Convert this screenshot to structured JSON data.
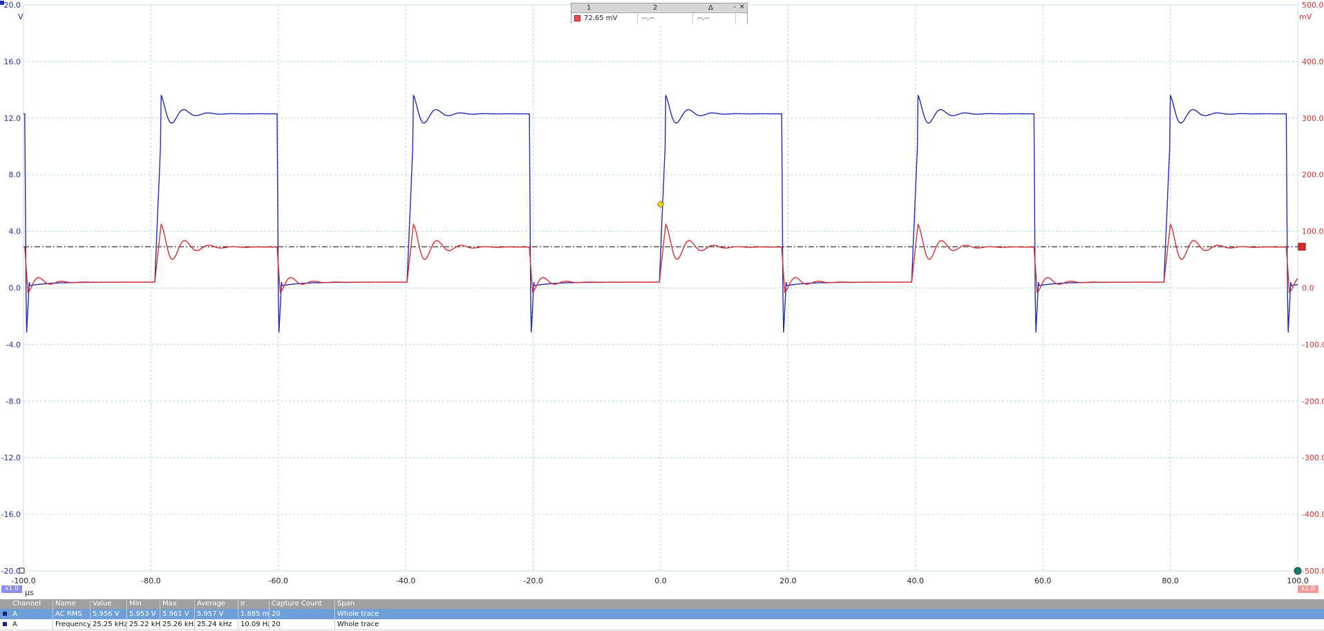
{
  "colors": {
    "channel_a": "#1f2bb4",
    "channel_b": "#d92d2d",
    "grid": "#b8d6dc",
    "trigger": "#e6d21a"
  },
  "axes": {
    "left_unit": "V",
    "right_unit": "mV",
    "x_unit": "µs",
    "left_ticks": [
      "20.0",
      "16.0",
      "12.0",
      "8.0",
      "4.0",
      "0.0",
      "-4.0",
      "-8.0",
      "-12.0",
      "-16.0",
      "-20.0"
    ],
    "right_ticks": [
      "500.0",
      "400.0",
      "300.0",
      "200.0",
      "100.0",
      "0.0",
      "-100.0",
      "-200.0",
      "-300.0",
      "-400.0",
      "-500.0"
    ],
    "x_ticks": [
      "-100.0",
      "-80.0",
      "-60.0",
      "-40.0",
      "-20.0",
      "0.0",
      "20.0",
      "40.0",
      "60.0",
      "80.0",
      "100.0"
    ],
    "left_scale": "x1.0",
    "right_scale": "x1.0"
  },
  "chart_data": {
    "type": "line",
    "x_unit": "µs",
    "xlim": [
      -100,
      100
    ],
    "ylim_left": [
      -20,
      20
    ],
    "ylim_right": [
      -500,
      500
    ],
    "grid": true,
    "period_us": 39.6,
    "edges_rise_us": [
      -79.4,
      -39.8,
      -0.2,
      39.4,
      79.0
    ],
    "edges_fall_us": [
      -99.8,
      -60.2,
      -20.6,
      19.0,
      58.6,
      98.2
    ],
    "series": [
      {
        "name": "A",
        "axis": "left",
        "unit": "V",
        "low_level": 0.4,
        "high_level": 12.3,
        "overshoot_peak": 13.7,
        "undershoot_peak": -3.6
      },
      {
        "name": "B",
        "axis": "right",
        "unit": "mV",
        "low_level": 10.0,
        "high_level": 72.0,
        "overshoot_peak": 112.0
      }
    ],
    "reference_level_mV": 72.65,
    "trigger": {
      "time_us": 0.0,
      "level_V": 5.9
    }
  },
  "ruler": {
    "headers": [
      "1",
      "2",
      "Δ"
    ],
    "values": [
      "72.65 mV",
      "--.--",
      "--.--"
    ],
    "minimize": "-",
    "close": "✕"
  },
  "measurements": {
    "headers": [
      "Channel",
      "Name",
      "Value",
      "Min",
      "Max",
      "Average",
      "σ",
      "Capture Count",
      "Span"
    ],
    "rows": [
      [
        "A",
        "AC RMS",
        "5.956 V",
        "5.953 V",
        "5.961 V",
        "5.957 V",
        "1.885 mV",
        "20",
        "Whole trace"
      ],
      [
        "A",
        "Frequency",
        "25.25 kHz",
        "25.22 kHz",
        "25.26 kHz",
        "25.24 kHz",
        "10.09 Hz",
        "20",
        "Whole trace"
      ]
    ]
  }
}
